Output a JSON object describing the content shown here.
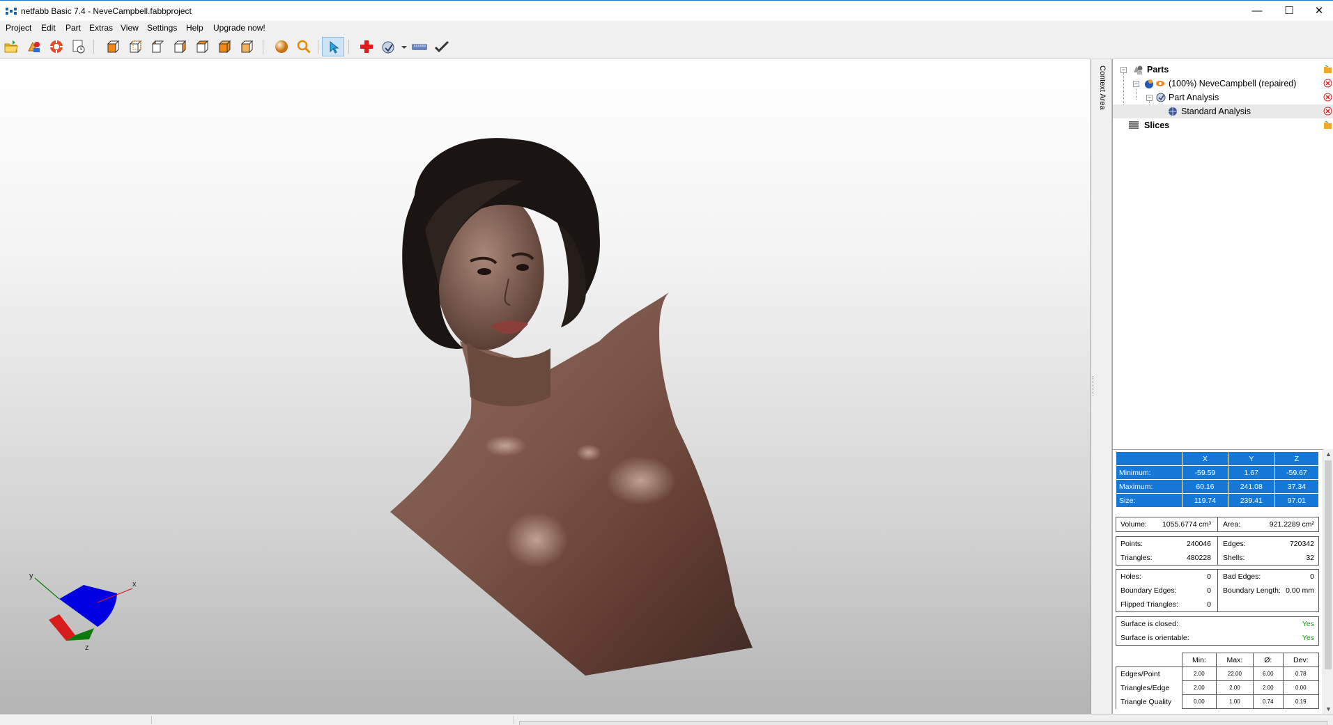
{
  "window": {
    "title": "netfabb Basic 7.4 - NeveCampbell.fabbproject",
    "controls": {
      "minimize": "—",
      "maximize": "☐",
      "close": "✕"
    }
  },
  "menu": [
    "Project",
    "Edit",
    "Part",
    "Extras",
    "View",
    "Settings",
    "Help",
    "Upgrade now!"
  ],
  "toolbar": {
    "buttons": [
      "open-icon",
      "add-part-icon",
      "repair-icon",
      "reports-icon",
      "view-front-icon",
      "view-back-icon",
      "view-left-icon",
      "view-right-icon",
      "view-top-icon",
      "view-bottom-icon",
      "view-iso-icon",
      "shading-sphere-icon",
      "zoom-icon",
      "select-pointer-icon",
      "repair-cross-icon",
      "measure-icon",
      "ruler-icon",
      "checkmark-icon"
    ],
    "active": "select-pointer-icon"
  },
  "viewport": {
    "axis_labels": {
      "x": "x",
      "y": "y",
      "z": "z"
    },
    "colors": {
      "x_axis": "#d81b1b",
      "y_axis": "#0d7a0d",
      "z_disc": "#0000e0"
    }
  },
  "side_tab": {
    "label": "Context Area"
  },
  "tree": {
    "parts_label": "Parts",
    "part_item": "(100%) NeveCampbell (repaired)",
    "analysis_group": "Part Analysis",
    "analysis_item": "Standard Analysis",
    "slices_label": "Slices"
  },
  "analysis": {
    "bbox": {
      "headers": [
        "",
        "X",
        "Y",
        "Z"
      ],
      "rows": [
        {
          "label": "Minimum:",
          "x": "-59.59",
          "y": "1.67",
          "z": "-59.67"
        },
        {
          "label": "Maximum:",
          "x": "60.16",
          "y": "241.08",
          "z": "37.34"
        },
        {
          "label": "Size:",
          "x": "119.74",
          "y": "239.41",
          "z": "97.01"
        }
      ],
      "color": "#1678d6"
    },
    "volume": {
      "label": "Volume:",
      "value": "1055.6774 cm³"
    },
    "area": {
      "label": "Area:",
      "value": "921.2289 cm²"
    },
    "points": {
      "label": "Points:",
      "value": "240046"
    },
    "triangles": {
      "label": "Triangles:",
      "value": "480228"
    },
    "edges": {
      "label": "Edges:",
      "value": "720342"
    },
    "shells": {
      "label": "Shells:",
      "value": "32"
    },
    "holes": {
      "label": "Holes:",
      "value": "0"
    },
    "boundary_edges": {
      "label": "Boundary Edges:",
      "value": "0"
    },
    "flipped_triangles": {
      "label": "Flipped Triangles:",
      "value": "0"
    },
    "bad_edges": {
      "label": "Bad Edges:",
      "value": "0"
    },
    "boundary_length": {
      "label": "Boundary Length:",
      "value": "0.00 mm"
    },
    "closed": {
      "label": "Surface is closed:",
      "value": "Yes"
    },
    "orientable": {
      "label": "Surface is orientable:",
      "value": "Yes"
    },
    "stats": {
      "headers": [
        "",
        "Min:",
        "Max:",
        "Ø:",
        "Dev:"
      ],
      "rows": [
        {
          "label": "Edges/Point",
          "min": "2.00",
          "max": "22.00",
          "avg": "6.00",
          "dev": "0.78"
        },
        {
          "label": "Triangles/Edge",
          "min": "2.00",
          "max": "2.00",
          "avg": "2.00",
          "dev": "0.00"
        },
        {
          "label": "Triangle Quality",
          "min": "0.00",
          "max": "1.00",
          "avg": "0.74",
          "dev": "0.19"
        }
      ]
    }
  }
}
